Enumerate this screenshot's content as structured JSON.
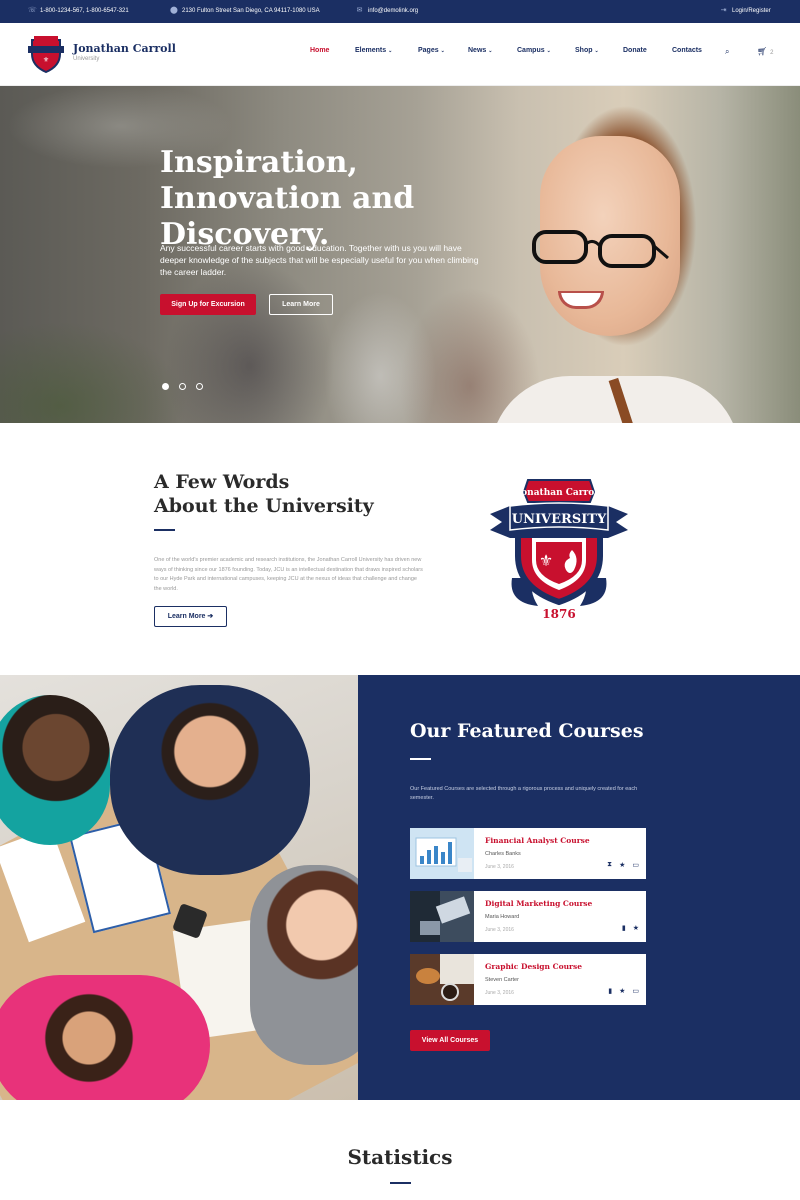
{
  "topbar": {
    "phone": "1-800-1234-567, 1-800-6547-321",
    "address": "2130 Fulton Street San Diego, CA 94117-1080 USA",
    "email": "info@demolink.org",
    "login": "Login/Register",
    "icons": {
      "phone": "phone-icon",
      "address": "map-pin-icon",
      "email": "envelope-icon",
      "login": "sign-in-icon"
    }
  },
  "header": {
    "brand_name": "Jonathan Carroll",
    "brand_sub": "University",
    "nav": [
      {
        "label": "Home",
        "active": true
      },
      {
        "label": "Elements"
      },
      {
        "label": "Pages"
      },
      {
        "label": "News"
      },
      {
        "label": "Campus"
      },
      {
        "label": "Shop"
      },
      {
        "label": "Donate"
      },
      {
        "label": "Contacts"
      }
    ],
    "cart_count": "2",
    "icons": {
      "search": "search-icon",
      "cart": "cart-icon"
    }
  },
  "hero": {
    "title": "Inspiration, Innovation and Discovery.",
    "text": "Any successful career starts with good education. Together with us you will have deeper knowledge of the subjects that will be especially useful for you when climbing the career ladder.",
    "primary_button": "Sign Up for Excursion",
    "secondary_button": "Learn More",
    "slides": 3,
    "active_slide": 1
  },
  "about": {
    "title_line1": "A Few Words",
    "title_line2": "About the University",
    "text": "One of the world's premier academic and research institutions, the Jonathan Carroll University has driven new ways of thinking since our 1876 founding. Today, JCU is an intellectual destination that draws inspired scholars to our Hyde Park and international campuses, keeping JCU at the nexus of ideas that challenge and change the world.",
    "button": "Learn More",
    "crest": {
      "banner": "Jonathan Carroll",
      "ribbon": "UNIVERSITY",
      "year": "1876"
    }
  },
  "featured": {
    "title": "Our Featured Courses",
    "text": "Our Featured Courses are selected through a rigorous process and uniquely created for each semester.",
    "courses": [
      {
        "title": "Financial Analyst Course",
        "author": "Charles Banks",
        "date": "June 3, 2016",
        "icons": [
          "hourglass-icon",
          "star-icon",
          "laptop-icon"
        ]
      },
      {
        "title": "Digital Marketing Course",
        "author": "Maria Howard",
        "date": "June 3, 2016",
        "icons": [
          "battery-icon",
          "star-icon"
        ]
      },
      {
        "title": "Graphic Design Course",
        "author": "Steven Carter",
        "date": "June 3, 2016",
        "icons": [
          "battery-icon",
          "star-icon",
          "laptop-icon"
        ]
      }
    ],
    "button": "View All Courses"
  },
  "stats": {
    "title": "Statistics"
  },
  "colors": {
    "navy": "#1b2f63",
    "red": "#c8102e"
  }
}
